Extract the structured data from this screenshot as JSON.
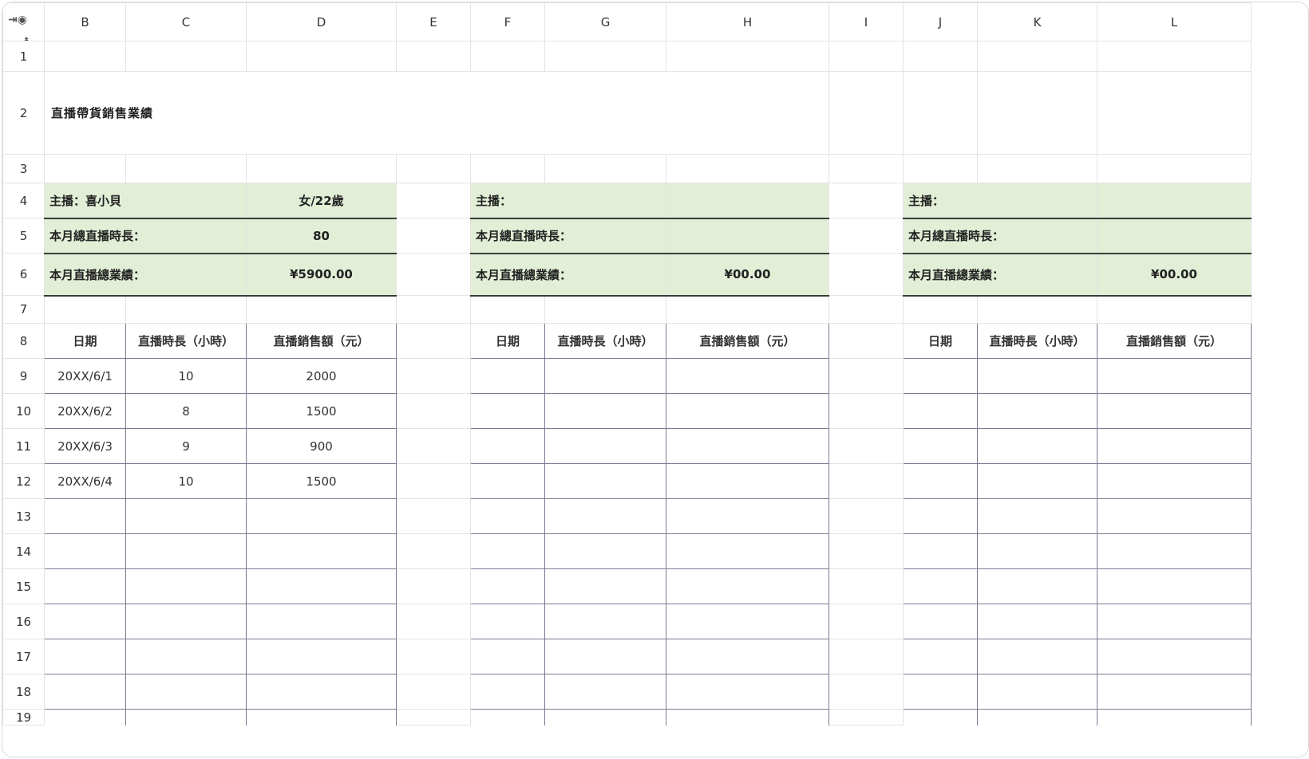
{
  "columns": [
    "B",
    "C",
    "D",
    "E",
    "F",
    "G",
    "H",
    "I",
    "J",
    "K",
    "L"
  ],
  "rows": [
    "1",
    "2",
    "3",
    "4",
    "5",
    "6",
    "7",
    "8",
    "9",
    "10",
    "11",
    "12",
    "13",
    "14",
    "15",
    "16",
    "17",
    "18",
    "19"
  ],
  "title": "直播帶貨銷售業績",
  "blocks": [
    {
      "host_label": "主播：喜小貝",
      "host_value": "女/22歲",
      "hours_label": "本月總直播時長：",
      "hours_value": "80",
      "sales_label": "本月直播總業績：",
      "sales_value": "¥5900.00",
      "headers": [
        "日期",
        "直播時長（小時）",
        "直播銷售額（元）"
      ],
      "rows": [
        [
          "20XX/6/1",
          "10",
          "2000"
        ],
        [
          "20XX/6/2",
          "8",
          "1500"
        ],
        [
          "20XX/6/3",
          "9",
          "900"
        ],
        [
          "20XX/6/4",
          "10",
          "1500"
        ]
      ]
    },
    {
      "host_label": "主播：",
      "host_value": "",
      "hours_label": "本月總直播時長：",
      "hours_value": "",
      "sales_label": "本月直播總業績：",
      "sales_value": "¥00.00",
      "headers": [
        "日期",
        "直播時長（小時）",
        "直播銷售額（元）"
      ],
      "rows": []
    },
    {
      "host_label": "主播：",
      "host_value": "",
      "hours_label": "本月總直播時長：",
      "hours_value": "",
      "sales_label": "本月直播總業績：",
      "sales_value": "¥00.00",
      "headers": [
        "日期",
        "直播時長（小時）",
        "直播銷售額（元）"
      ],
      "rows": []
    }
  ],
  "colors": {
    "info_fill": "#e2eed6",
    "grid_line": "#e3e3e3",
    "table_border": "#7a7a93"
  },
  "icons": [
    "eye-icon",
    "freeze-columns-icon",
    "freeze-rows-icon"
  ]
}
